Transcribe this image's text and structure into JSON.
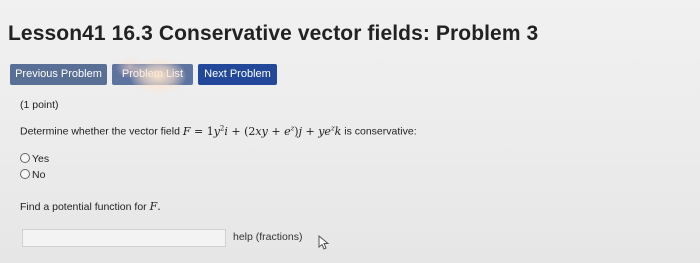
{
  "title": "Lesson41 16.3 Conservative vector fields: Problem 3",
  "nav": {
    "previous": "Previous Problem",
    "list": "Problem List",
    "next": "Next Problem"
  },
  "points": "(1 point)",
  "question": {
    "prefix": "Determine whether the vector field",
    "suffix": "is conservative:"
  },
  "options": {
    "yes": "Yes",
    "no": "No"
  },
  "find": {
    "prefix": "Find a potential function for"
  },
  "answer": {
    "value": ""
  },
  "help_link": "help (fractions)",
  "colors": {
    "button_prev": "#5a6f95",
    "button_list": "#5d73a0",
    "button_next": "#23489a"
  },
  "icons": {
    "cursor": "mouse-pointer-icon"
  }
}
